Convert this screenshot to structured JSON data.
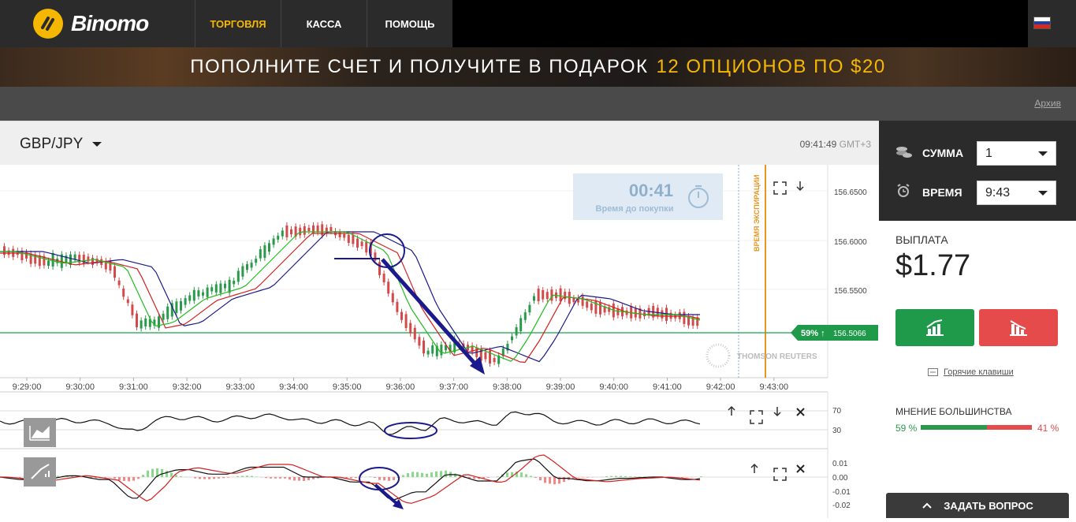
{
  "brand": {
    "name": "Binomo"
  },
  "nav": {
    "items": [
      "ТОРГОВЛЯ",
      "КАССА",
      "ПОМОЩЬ"
    ]
  },
  "banner": {
    "text": "ПОПОЛНИТЕ СЧЕТ И ПОЛУЧИТЕ В ПОДАРОК",
    "highlight": "12 ОПЦИОНОВ ПО $20"
  },
  "subbar": {
    "archive": "Архив"
  },
  "chart": {
    "pair": "GBP/JPY",
    "time": "09:41:49",
    "tz": "GMT+3",
    "timer": {
      "value": "00:41",
      "label": "Время до покупки"
    },
    "expiry_label": "ВРЕМЯ ЭКСПИРАЦИИ",
    "price_ticks": [
      "156.6500",
      "156.6000",
      "156.5500",
      "156.5066"
    ],
    "current_price": "156.5066",
    "current_pct": "59% ↑",
    "watermark": "THOMSON REUTERS",
    "time_ticks": [
      "9:29:00",
      "9:30:00",
      "9:31:00",
      "9:32:00",
      "9:33:00",
      "9:34:00",
      "9:35:00",
      "9:36:00",
      "9:37:00",
      "9:38:00",
      "9:39:00",
      "9:40:00",
      "9:41:00",
      "9:42:00",
      "9:43:00"
    ],
    "rsi_ticks": [
      "70",
      "30"
    ],
    "macd_ticks": [
      "0.01",
      "0.00",
      "-0.01",
      "-0.02"
    ]
  },
  "panel": {
    "amount_label": "СУММА",
    "amount_value": "1",
    "time_label": "ВРЕМЯ",
    "time_value": "9:43",
    "payout_label": "ВЫПЛАТА",
    "payout_value": "$1.77",
    "hotkeys": "Горячие клавиши",
    "opinion_label": "МНЕНИЕ БОЛЬШИНСТВА",
    "opinion_up": "59 %",
    "opinion_down": "41 %",
    "ask": "ЗАДАТЬ ВОПРОС"
  },
  "colors": {
    "accent": "#f5b700",
    "up": "#1f9a4a",
    "down": "#e54b4b",
    "ma_blue": "#1a1a8c",
    "ma_red": "#d42020",
    "ma_green": "#22bb22"
  }
}
